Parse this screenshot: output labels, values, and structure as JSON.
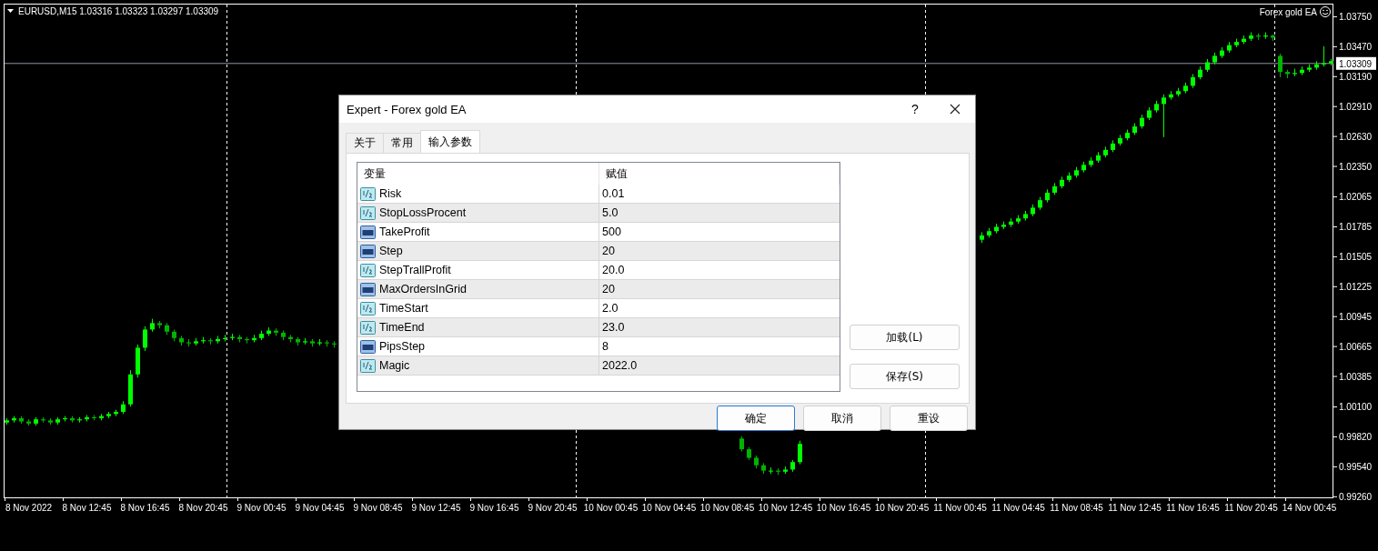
{
  "chart": {
    "symbol_line": "EURUSD,M15  1.03316 1.03323 1.03297 1.03309",
    "expert_name": "Forex gold EA",
    "chart_data": {
      "type": "candlestick",
      "ylim": [
        0.9925,
        1.0386
      ],
      "ref_lines": [
        {
          "axis": "y",
          "value": 1.03309,
          "label": "1.03309"
        }
      ],
      "yticks": [
        {
          "value": 1.0375,
          "label": "1.03750"
        },
        {
          "value": 1.0347,
          "label": "1.03470"
        },
        {
          "value": 1.0319,
          "label": "1.03190"
        },
        {
          "value": 1.0291,
          "label": "1.02910"
        },
        {
          "value": 1.0263,
          "label": "1.02630"
        },
        {
          "value": 1.0235,
          "label": "1.02350"
        },
        {
          "value": 1.02065,
          "label": "1.02065"
        },
        {
          "value": 1.01785,
          "label": "1.01785"
        },
        {
          "value": 1.01505,
          "label": "1.01505"
        },
        {
          "value": 1.01225,
          "label": "1.01225"
        },
        {
          "value": 1.00945,
          "label": "1.00945"
        },
        {
          "value": 1.00665,
          "label": "1.00665"
        },
        {
          "value": 1.00385,
          "label": "1.00385"
        },
        {
          "value": 1.001,
          "label": "1.00100"
        },
        {
          "value": 0.9982,
          "label": "0.99820"
        },
        {
          "value": 0.9954,
          "label": "0.99540"
        },
        {
          "value": 0.9926,
          "label": "0.99260"
        }
      ],
      "categories": [
        null,
        null,
        null,
        "8 Nov 2022",
        null,
        null,
        null,
        null,
        null,
        null,
        null,
        "8 Nov 12:45",
        null,
        null,
        null,
        null,
        null,
        null,
        null,
        "8 Nov 16:45",
        null,
        null,
        null,
        null,
        null,
        null,
        null,
        "8 Nov 20:45",
        null,
        null,
        null,
        null,
        null,
        null,
        null,
        "9 Nov 00:45",
        null,
        null,
        null,
        null,
        null,
        null,
        null,
        "9 Nov 04:45",
        null,
        null,
        null,
        null,
        null,
        null,
        null,
        "9 Nov 08:45",
        null,
        null,
        null,
        null,
        null,
        null,
        null,
        "9 Nov 12:45",
        null,
        null,
        null,
        null,
        null,
        null,
        null,
        "9 Nov 16:45",
        null,
        null,
        null,
        null,
        null,
        null,
        null,
        "9 Nov 20:45",
        null,
        null,
        null,
        null,
        null,
        null,
        null,
        "10 Nov 00:45",
        null,
        null,
        null,
        null,
        null,
        null,
        null,
        "10 Nov 04:45",
        null,
        null,
        null,
        null,
        null,
        null,
        null,
        "10 Nov 08:45",
        null,
        null,
        null,
        null,
        null,
        null,
        null,
        "10 Nov 12:45",
        null,
        null,
        null,
        null,
        null,
        null,
        null,
        "10 Nov 16:45",
        null,
        null,
        null,
        null,
        null,
        null,
        null,
        "10 Nov 20:45",
        null,
        null,
        null,
        null,
        null,
        null,
        null,
        "11 Nov 00:45",
        null,
        null,
        null,
        null,
        null,
        null,
        null,
        "11 Nov 04:45",
        null,
        null,
        null,
        null,
        null,
        null,
        null,
        "11 Nov 08:45",
        null,
        null,
        null,
        null,
        null,
        null,
        null,
        "11 Nov 12:45",
        null,
        null,
        null,
        null,
        null,
        null,
        null,
        "11 Nov 16:45",
        null,
        null,
        null,
        null,
        null,
        null,
        null,
        "11 Nov 20:45",
        null,
        null,
        null,
        null,
        null,
        null,
        null,
        "14 Nov 00:45",
        null,
        null,
        null
      ],
      "ohlc": [
        [
          0.9995,
          0.9999,
          0.9993,
          0.9997
        ],
        [
          0.9997,
          1.0001,
          0.9995,
          0.9999
        ],
        [
          0.9999,
          1.0001,
          0.9994,
          0.9996
        ],
        [
          0.9996,
          0.9998,
          0.9992,
          0.9994
        ],
        [
          0.9994,
          1.0,
          0.9992,
          0.9998
        ],
        [
          0.9998,
          1.0,
          0.9995,
          0.9997
        ],
        [
          0.9997,
          0.9999,
          0.9993,
          0.9995
        ],
        [
          0.9995,
          1.0,
          0.9993,
          0.9998
        ],
        [
          0.9998,
          1.0001,
          0.9996,
          0.9999
        ],
        [
          0.9999,
          1.0001,
          0.9995,
          0.9997
        ],
        [
          0.9997,
          1.0,
          0.9995,
          0.9998
        ],
        [
          0.9998,
          1.0002,
          0.9996,
          1.0
        ],
        [
          1.0,
          1.0002,
          0.9997,
          0.9999
        ],
        [
          0.9999,
          1.0003,
          0.9997,
          1.0001
        ],
        [
          1.0001,
          1.0005,
          0.9999,
          1.0003
        ],
        [
          1.0003,
          1.0007,
          1.0001,
          1.0005
        ],
        [
          1.0005,
          1.0015,
          1.0003,
          1.0012
        ],
        [
          1.0012,
          1.0044,
          1.001,
          1.004
        ],
        [
          1.004,
          1.0068,
          1.0037,
          1.0065
        ],
        [
          1.0065,
          1.0085,
          1.0062,
          1.0082
        ],
        [
          1.0082,
          1.0092,
          1.008,
          1.0088
        ],
        [
          1.0088,
          1.009,
          1.0083,
          1.0086
        ],
        [
          1.0086,
          1.0088,
          1.0077,
          1.008
        ],
        [
          1.008,
          1.0082,
          1.0071,
          1.0074
        ],
        [
          1.0074,
          1.0076,
          1.0067,
          1.007
        ],
        [
          1.007,
          1.0073,
          1.0066,
          1.0069
        ],
        [
          1.0069,
          1.0074,
          1.0067,
          1.0071
        ],
        [
          1.0071,
          1.0075,
          1.0069,
          1.0072
        ],
        [
          1.0072,
          1.0074,
          1.0068,
          1.0071
        ],
        [
          1.0071,
          1.0076,
          1.0069,
          1.0073
        ],
        [
          1.0073,
          1.0077,
          1.0071,
          1.0074
        ],
        [
          1.0074,
          1.0078,
          1.0072,
          1.0075
        ],
        [
          1.0075,
          1.0077,
          1.007,
          1.0073
        ],
        [
          1.0073,
          1.0075,
          1.0069,
          1.0072
        ],
        [
          1.0072,
          1.0077,
          1.007,
          1.0074
        ],
        [
          1.0074,
          1.0081,
          1.0072,
          1.0078
        ],
        [
          1.0078,
          1.0084,
          1.0076,
          1.0081
        ],
        [
          1.0081,
          1.0083,
          1.0076,
          1.0079
        ],
        [
          1.0079,
          1.0081,
          1.0072,
          1.0075
        ],
        [
          1.0075,
          1.0077,
          1.007,
          1.0073
        ],
        [
          1.0073,
          1.0075,
          1.0067,
          1.007
        ],
        [
          1.007,
          1.0074,
          1.0068,
          1.0071
        ],
        [
          1.0071,
          1.0073,
          1.0066,
          1.0069
        ],
        [
          1.0069,
          1.0073,
          1.0067,
          1.007
        ],
        [
          1.007,
          1.0072,
          1.0066,
          1.0069
        ],
        [
          1.0069,
          1.0071,
          1.0065,
          1.0068
        ],
        null,
        null,
        null,
        null,
        null,
        null,
        null,
        null,
        null,
        null,
        null,
        null,
        null,
        null,
        null,
        null,
        null,
        null,
        null,
        null,
        null,
        null,
        null,
        null,
        null,
        null,
        null,
        null,
        null,
        null,
        null,
        null,
        null,
        null,
        null,
        null,
        null,
        null,
        null,
        null,
        null,
        null,
        null,
        null,
        null,
        null,
        null,
        null,
        null,
        null,
        null,
        null,
        null,
        null,
        null,
        [
          0.998,
          0.9982,
          0.9968,
          0.997
        ],
        [
          0.997,
          0.9972,
          0.996,
          0.9962
        ],
        [
          0.9962,
          0.9964,
          0.9952,
          0.9955
        ],
        [
          0.9955,
          0.9957,
          0.9947,
          0.995
        ],
        [
          0.995,
          0.9953,
          0.9947,
          0.995
        ],
        [
          0.995,
          0.9952,
          0.9946,
          0.9949
        ],
        [
          0.9949,
          0.9954,
          0.9947,
          0.9951
        ],
        [
          0.9951,
          0.996,
          0.9949,
          0.9958
        ],
        [
          0.9958,
          0.9978,
          0.9956,
          0.9975
        ],
        null,
        null,
        null,
        null,
        null,
        null,
        null,
        null,
        null,
        null,
        null,
        null,
        null,
        null,
        null,
        null,
        null,
        null,
        null,
        null,
        null,
        null,
        null,
        null,
        [
          1.0166,
          1.0173,
          1.0163,
          1.017
        ],
        [
          1.017,
          1.0177,
          1.0168,
          1.0174
        ],
        [
          1.0174,
          1.0181,
          1.0172,
          1.0178
        ],
        [
          1.0178,
          1.0183,
          1.0176,
          1.018
        ],
        [
          1.018,
          1.0186,
          1.0178,
          1.0183
        ],
        [
          1.0183,
          1.0189,
          1.0181,
          1.0186
        ],
        [
          1.0186,
          1.0193,
          1.0184,
          1.019
        ],
        [
          1.019,
          1.0199,
          1.0188,
          1.0196
        ],
        [
          1.0196,
          1.0206,
          1.0194,
          1.0203
        ],
        [
          1.0203,
          1.0213,
          1.0201,
          1.021
        ],
        [
          1.021,
          1.0219,
          1.0208,
          1.0216
        ],
        [
          1.0216,
          1.0225,
          1.0214,
          1.0222
        ],
        [
          1.0222,
          1.0229,
          1.022,
          1.0226
        ],
        [
          1.0226,
          1.0234,
          1.0224,
          1.0231
        ],
        [
          1.0231,
          1.0239,
          1.0229,
          1.0236
        ],
        [
          1.0236,
          1.0243,
          1.0234,
          1.024
        ],
        [
          1.024,
          1.0248,
          1.0238,
          1.0245
        ],
        [
          1.0245,
          1.0253,
          1.0243,
          1.025
        ],
        [
          1.025,
          1.0259,
          1.0248,
          1.0256
        ],
        [
          1.0256,
          1.0264,
          1.0254,
          1.0261
        ],
        [
          1.0261,
          1.0269,
          1.0259,
          1.0266
        ],
        [
          1.0266,
          1.0275,
          1.0264,
          1.0272
        ],
        [
          1.0272,
          1.0283,
          1.027,
          1.028
        ],
        [
          1.028,
          1.029,
          1.0278,
          1.0287
        ],
        [
          1.0287,
          1.0296,
          1.0285,
          1.0293
        ],
        [
          1.0293,
          1.0302,
          1.0262,
          1.0299
        ],
        [
          1.0299,
          1.0305,
          1.0297,
          1.0302
        ],
        [
          1.0302,
          1.0308,
          1.03,
          1.0305
        ],
        [
          1.0305,
          1.0313,
          1.0303,
          1.031
        ],
        [
          1.031,
          1.0321,
          1.0308,
          1.0318
        ],
        [
          1.0318,
          1.0328,
          1.0316,
          1.0325
        ],
        [
          1.0325,
          1.0335,
          1.0323,
          1.0332
        ],
        [
          1.0332,
          1.0341,
          1.033,
          1.0338
        ],
        [
          1.0338,
          1.0346,
          1.0336,
          1.0343
        ],
        [
          1.0343,
          1.0351,
          1.0341,
          1.0348
        ],
        [
          1.0348,
          1.0354,
          1.0346,
          1.0351
        ],
        [
          1.0351,
          1.0357,
          1.0349,
          1.0354
        ],
        [
          1.0354,
          1.036,
          1.0352,
          1.0357
        ],
        [
          1.0357,
          1.0359,
          1.0353,
          1.0356
        ],
        [
          1.0356,
          1.036,
          1.0354,
          1.0357
        ],
        [
          1.0357,
          1.0358,
          1.0352,
          1.0355
        ],
        [
          1.0338,
          1.034,
          1.0318,
          1.0323
        ],
        [
          1.0323,
          1.0325,
          1.0317,
          1.0321
        ],
        [
          1.0321,
          1.0326,
          1.0319,
          1.0322
        ],
        [
          1.0322,
          1.0328,
          1.032,
          1.0325
        ],
        [
          1.0325,
          1.033,
          1.0323,
          1.0327
        ],
        [
          1.0327,
          1.0333,
          1.0325,
          1.033
        ],
        [
          1.033,
          1.0347,
          1.0328,
          1.0331
        ],
        [
          1.0331,
          1.0335,
          1.0329,
          1.0333
        ]
      ]
    }
  },
  "dialog": {
    "title": "Expert - Forex gold EA",
    "help": "?",
    "tabs": [
      {
        "label": "关于",
        "selected": false
      },
      {
        "label": "常用",
        "selected": false
      },
      {
        "label": "输入参数",
        "selected": true
      }
    ],
    "table": {
      "columns": [
        "变量",
        "赋值"
      ],
      "rows": [
        {
          "kind": "double",
          "name": "Risk",
          "value": "0.01"
        },
        {
          "kind": "double",
          "name": "StopLossProcent",
          "value": "5.0"
        },
        {
          "kind": "int",
          "name": "TakeProfit",
          "value": "500"
        },
        {
          "kind": "int",
          "name": "Step",
          "value": "20"
        },
        {
          "kind": "double",
          "name": "StepTrallProfit",
          "value": "20.0"
        },
        {
          "kind": "int",
          "name": "MaxOrdersInGrid",
          "value": "20"
        },
        {
          "kind": "double",
          "name": "TimeStart",
          "value": "2.0"
        },
        {
          "kind": "double",
          "name": "TimeEnd",
          "value": "23.0"
        },
        {
          "kind": "int",
          "name": "PipsStep",
          "value": "8"
        },
        {
          "kind": "double",
          "name": "Magic",
          "value": "2022.0"
        }
      ]
    },
    "side_buttons": [
      "加载(L)",
      "保存(S)"
    ],
    "buttons": [
      {
        "label": "确定",
        "default": true
      },
      {
        "label": "取消",
        "default": false
      },
      {
        "label": "重设",
        "default": false
      }
    ]
  }
}
